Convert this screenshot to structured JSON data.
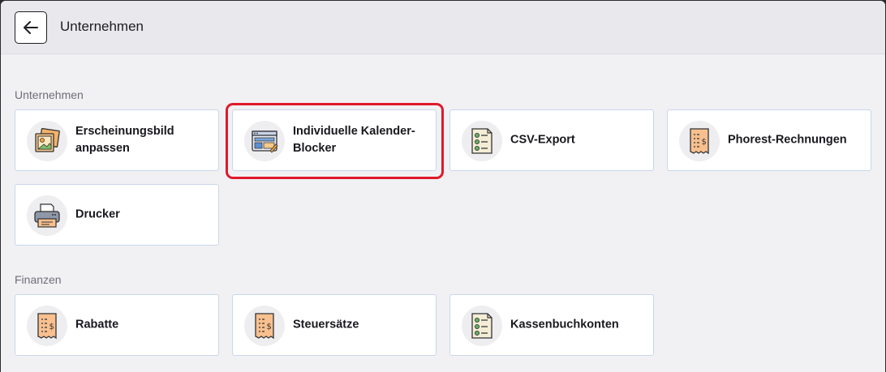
{
  "header": {
    "title": "Unternehmen"
  },
  "sections": [
    {
      "title": "Unternehmen",
      "cards": [
        {
          "label": "Erscheinungsbild anpassen",
          "icon": "picture-icon"
        },
        {
          "label": "Individuelle Kalender-Blocker",
          "icon": "calendar-window-icon"
        },
        {
          "label": "CSV-Export",
          "icon": "checklist-icon"
        },
        {
          "label": "Phorest-Rechnungen",
          "icon": "receipt-icon"
        },
        {
          "label": "Drucker",
          "icon": "printer-icon"
        }
      ]
    },
    {
      "title": "Finanzen",
      "cards": [
        {
          "label": "Rabatte",
          "icon": "receipt-icon"
        },
        {
          "label": "Steuersätze",
          "icon": "receipt-icon"
        },
        {
          "label": "Kassenbuchkonten",
          "icon": "checklist-icon"
        }
      ]
    }
  ],
  "colors": {
    "highlight": "#e0192b",
    "card_border": "#c9d6ea",
    "receipt": "#f9c08f",
    "checklist_dot": "#5fb05f"
  }
}
